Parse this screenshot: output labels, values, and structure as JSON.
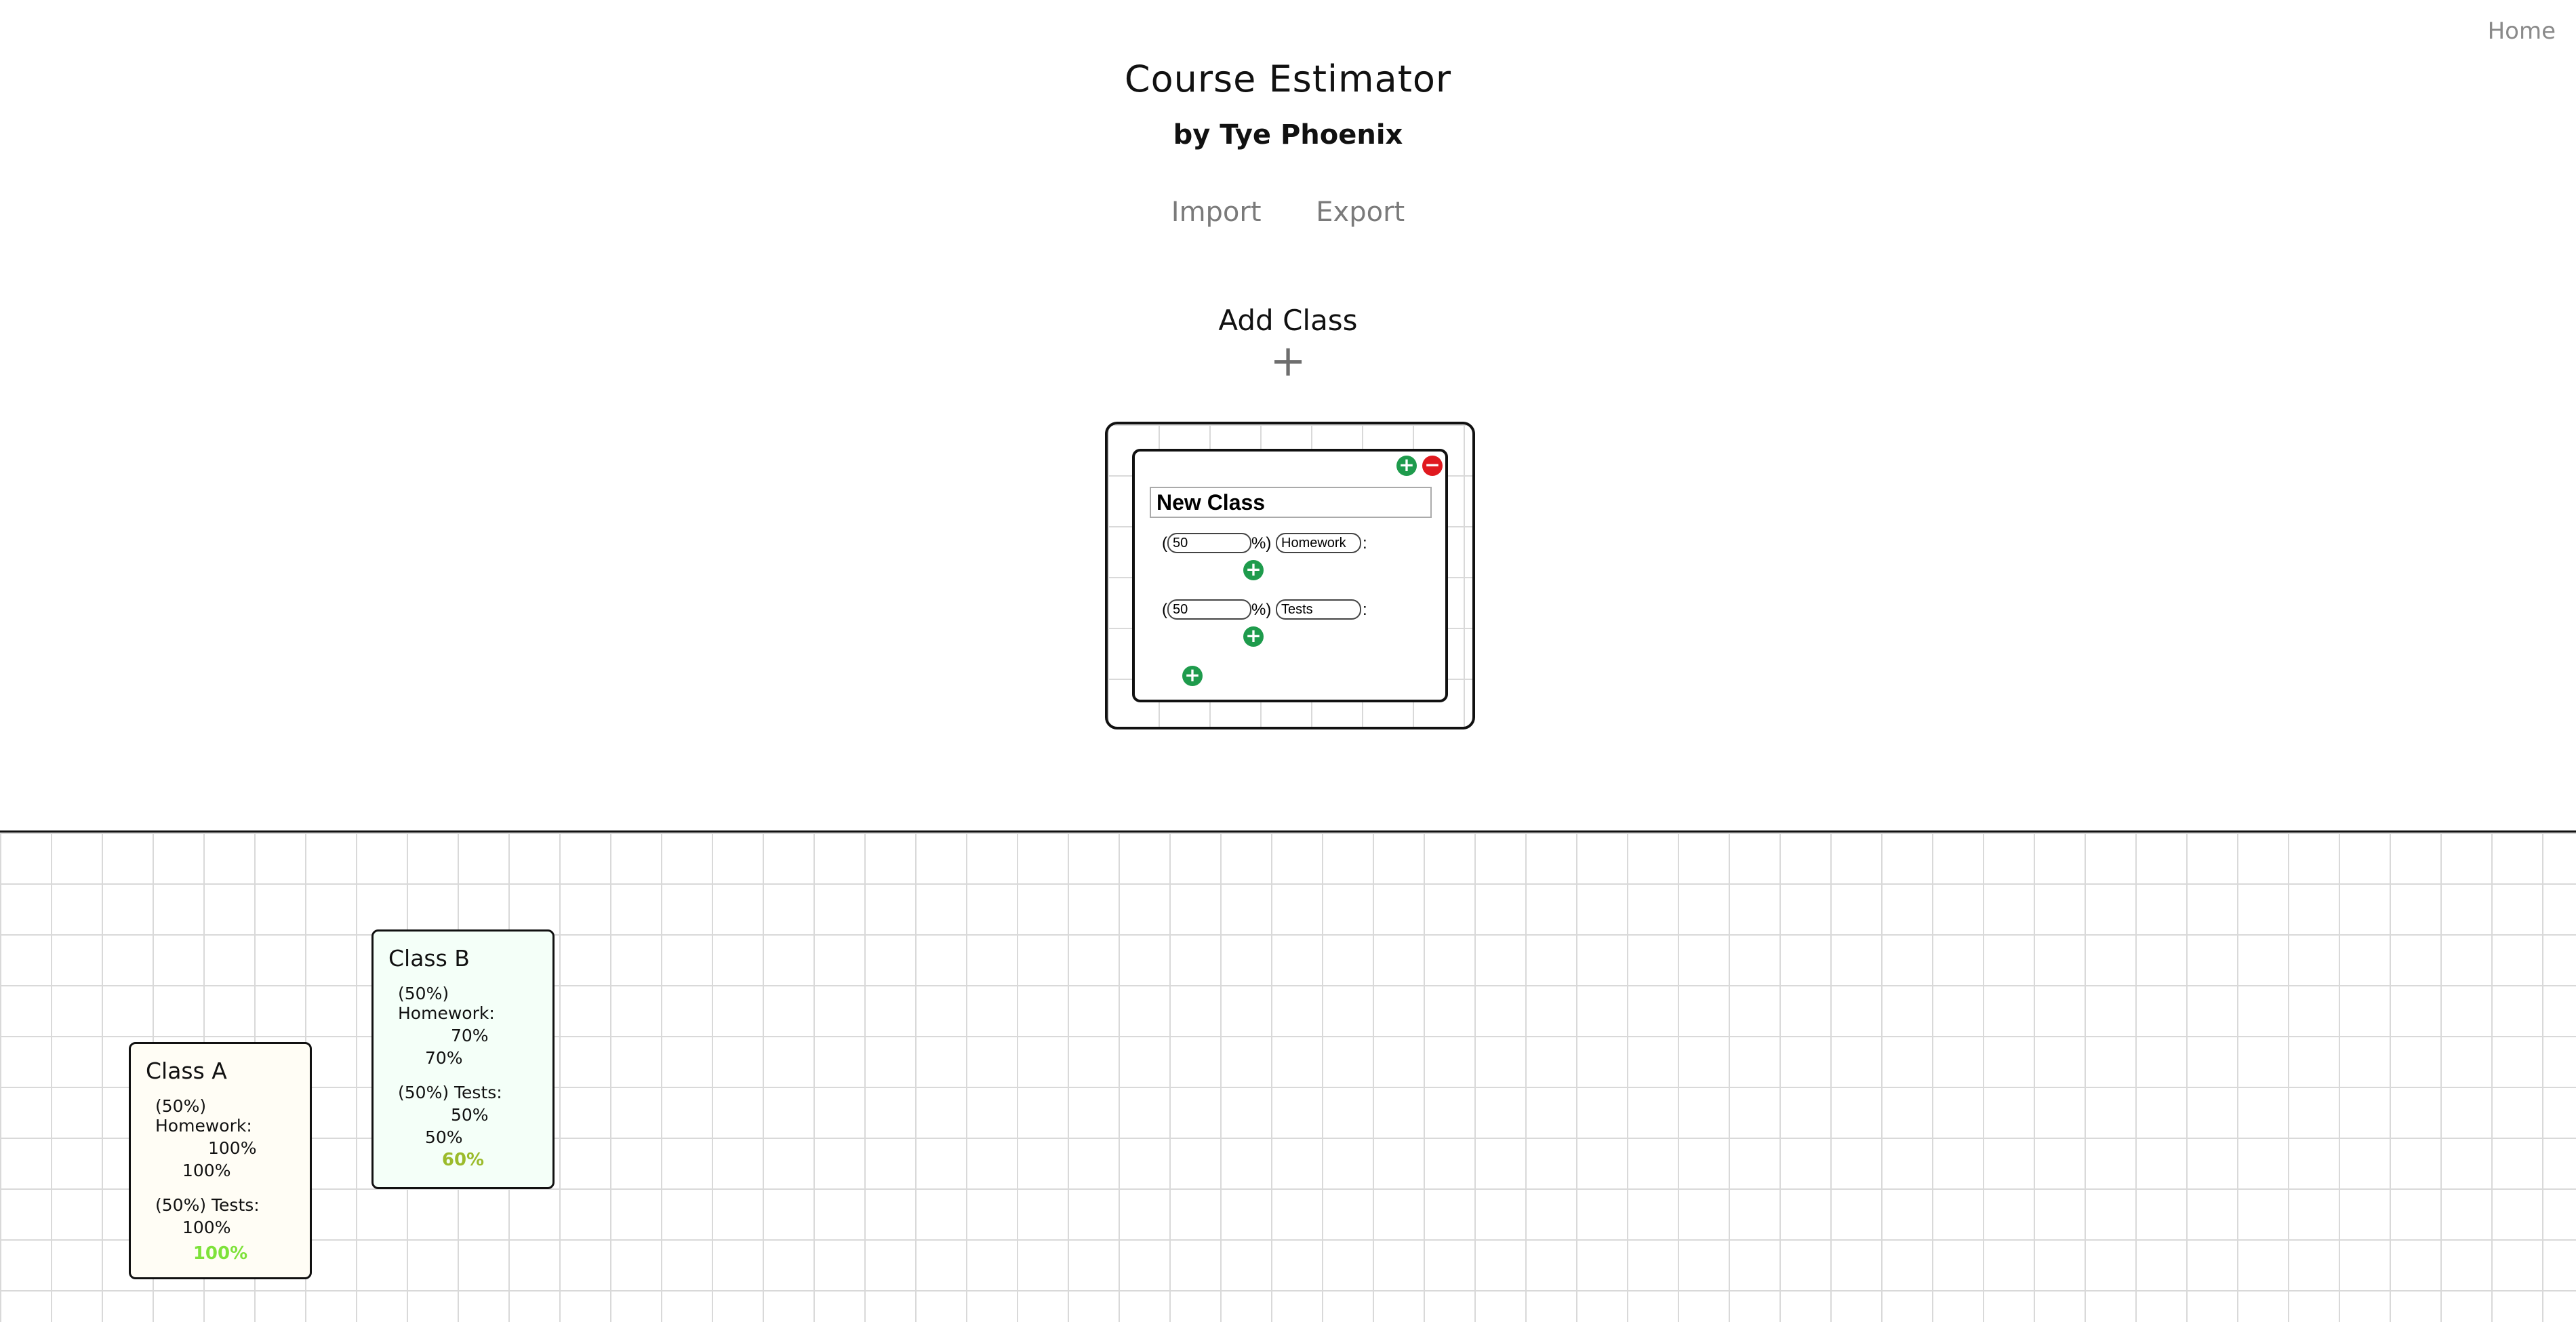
{
  "nav": {
    "home": "Home"
  },
  "header": {
    "title": "Course Estimator",
    "subtitle": "by Tye Phoenix"
  },
  "actions": {
    "import": "Import",
    "export": "Export"
  },
  "add_class": {
    "label": "Add Class",
    "plus_icon": "+"
  },
  "editor": {
    "class_name": "New Class",
    "categories": [
      {
        "weight": "50",
        "name": "Homework"
      },
      {
        "weight": "50",
        "name": "Tests"
      }
    ],
    "open_paren": "(",
    "percent_close": "%)",
    "colon": ":"
  },
  "classes": [
    {
      "name": "Class A",
      "categories": [
        {
          "label": "(50%) Homework:",
          "score": "100%",
          "grade": "100%"
        },
        {
          "label": "(50%) Tests:",
          "score": "100%"
        }
      ],
      "total": "100%",
      "total_color": "#7ee23a",
      "background": "#fffdf5"
    },
    {
      "name": "Class B",
      "categories": [
        {
          "label": "(50%) Homework:",
          "score": "70%",
          "grade": "70%"
        },
        {
          "label": "(50%) Tests:",
          "score": "50%",
          "grade": "50%"
        }
      ],
      "total": "60%",
      "total_color": "#9bbb2b",
      "background": "#f4fff8"
    }
  ],
  "colors": {
    "add_green": "#1e9b4c",
    "remove_red": "#e0191f"
  }
}
